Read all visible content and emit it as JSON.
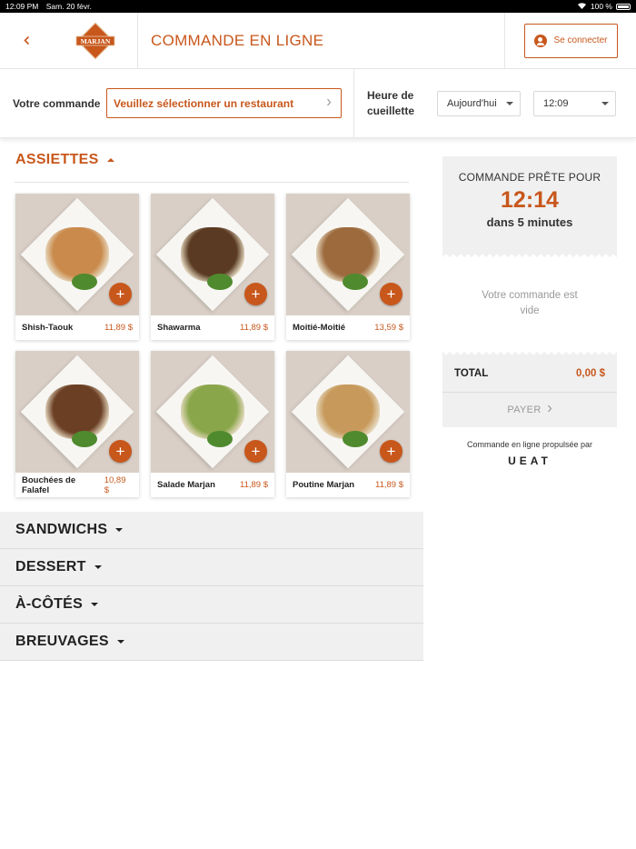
{
  "status_bar": {
    "time": "12:09 PM",
    "date": "Sam. 20 févr.",
    "battery": "100 %"
  },
  "header": {
    "title": "COMMANDE EN LIGNE",
    "login_label": "Se connecter",
    "logo_text": "MARJAN"
  },
  "order_bar": {
    "order_label": "Votre commande",
    "restaurant_placeholder": "Veuillez sélectionner un restaurant",
    "pickup_label_line1": "Heure de",
    "pickup_label_line2": "cueillette",
    "day": "Aujourd'hui",
    "time": "12:09"
  },
  "active_category": "ASSIETTES",
  "products": [
    {
      "name": "Shish-Taouk",
      "price": "11,89 $",
      "food_color": "#c98a4b"
    },
    {
      "name": "Shawarma",
      "price": "11,89 $",
      "food_color": "#5a3a22"
    },
    {
      "name": "Moitié-Moitié",
      "price": "13,59 $",
      "food_color": "#9c6a3d"
    },
    {
      "name": "Bouchées de Falafel",
      "price": "10,89 $",
      "food_color": "#6b3f24"
    },
    {
      "name": "Salade Marjan",
      "price": "11,89 $",
      "food_color": "#8aa64a"
    },
    {
      "name": "Poutine Marjan",
      "price": "11,89 $",
      "food_color": "#c79a5c"
    }
  ],
  "categories": [
    "SANDWICHS",
    "DESSERT",
    "À-CÔTÉS",
    "BREUVAGES"
  ],
  "cart": {
    "ready_title": "COMMANDE PRÊTE POUR",
    "ready_time": "12:14",
    "ready_eta": "dans 5 minutes",
    "empty_text": "Votre commande est vide",
    "total_label": "TOTAL",
    "total_value": "0,00 $",
    "pay_label": "PAYER",
    "powered_by": "Commande en ligne propulsée par",
    "brand": "UEAT"
  },
  "colors": {
    "accent": "#c8571c",
    "panel": "#f0f0f0"
  }
}
